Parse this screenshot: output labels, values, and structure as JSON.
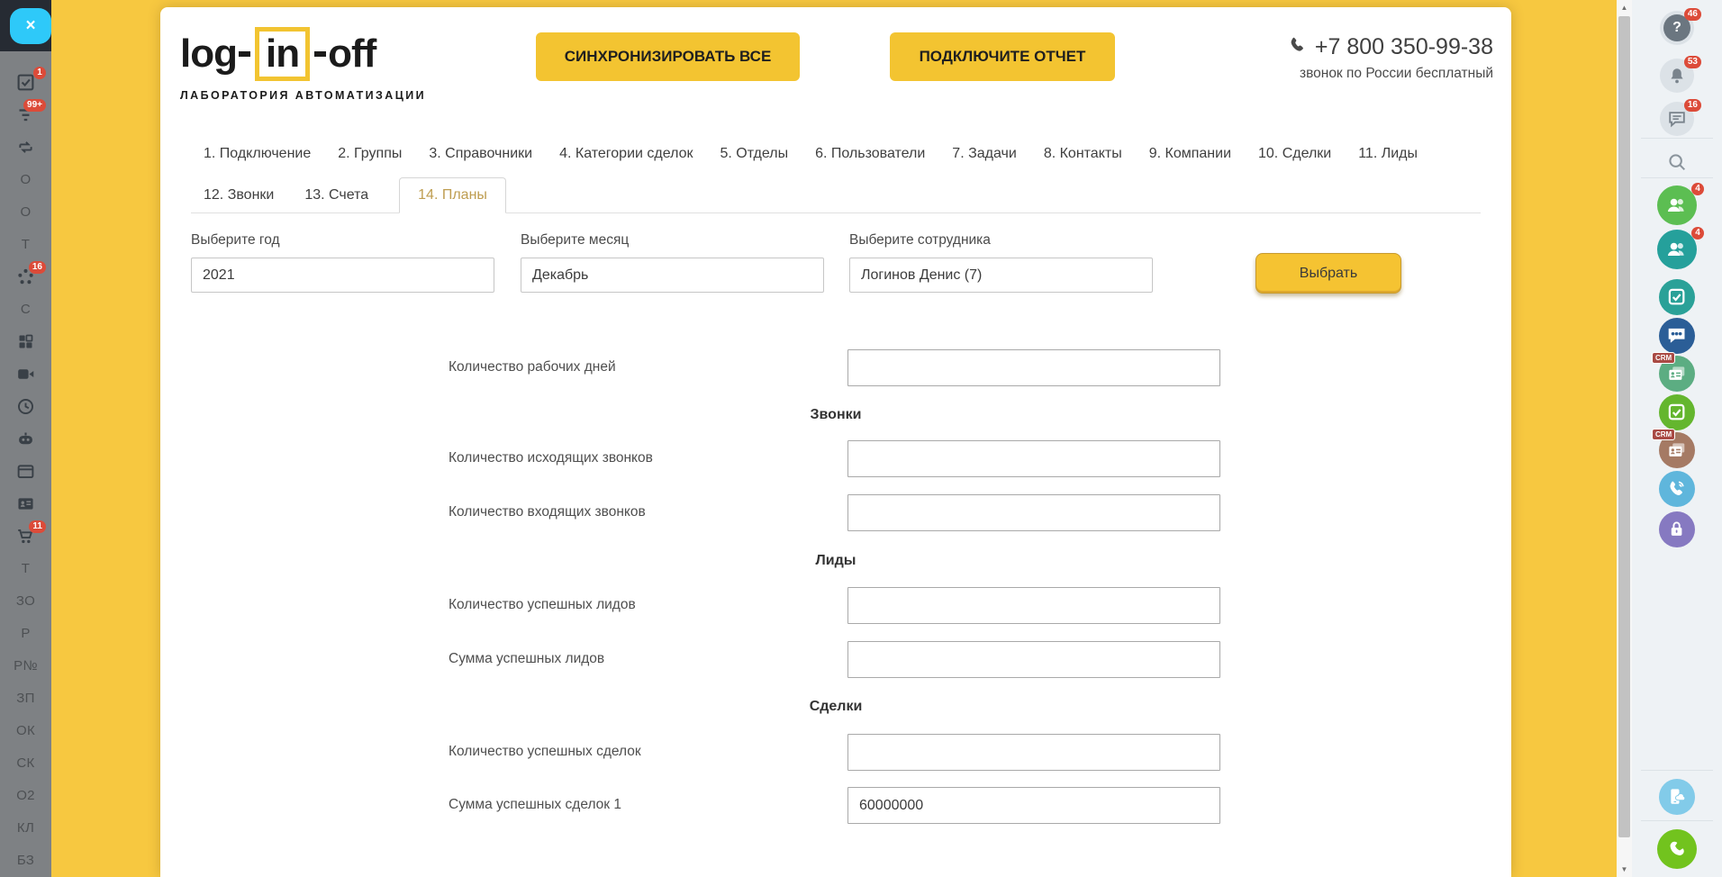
{
  "left_sidebar": {
    "close_label": "×",
    "items": [
      {
        "type": "icon",
        "icon": "tasks",
        "name": "tasks-icon",
        "badge": "1"
      },
      {
        "type": "icon",
        "icon": "filter",
        "name": "filter-icon",
        "badge": "99+"
      },
      {
        "type": "icon",
        "icon": "sync",
        "name": "sync-icon"
      },
      {
        "type": "text",
        "label": "О"
      },
      {
        "type": "text",
        "label": "О"
      },
      {
        "type": "text",
        "label": "Т"
      },
      {
        "type": "icon",
        "icon": "network",
        "name": "network-icon",
        "badge": "16"
      },
      {
        "type": "text",
        "label": "С"
      },
      {
        "type": "icon",
        "icon": "grid",
        "name": "apps-grid-icon"
      },
      {
        "type": "icon",
        "icon": "video",
        "name": "video-icon"
      },
      {
        "type": "icon",
        "icon": "clock",
        "name": "clock-icon"
      },
      {
        "type": "icon",
        "icon": "robot",
        "name": "robot-icon"
      },
      {
        "type": "icon",
        "icon": "window",
        "name": "browser-window-icon"
      },
      {
        "type": "icon",
        "icon": "idcard",
        "name": "contact-card-icon"
      },
      {
        "type": "icon",
        "icon": "cart",
        "name": "cart-icon",
        "badge": "11"
      },
      {
        "type": "text",
        "label": "Т"
      },
      {
        "type": "text",
        "label": "ЗО"
      },
      {
        "type": "text",
        "label": "Р"
      },
      {
        "type": "text",
        "label": "P№"
      },
      {
        "type": "text",
        "label": "ЗП"
      },
      {
        "type": "text",
        "label": "ОК"
      },
      {
        "type": "text",
        "label": "СК"
      },
      {
        "type": "text",
        "label": "О2"
      },
      {
        "type": "text",
        "label": "КЛ"
      },
      {
        "type": "text",
        "label": "БЗ"
      }
    ]
  },
  "header": {
    "logo": {
      "part1": "log",
      "part2": "in",
      "part3": "off",
      "subtitle": "ЛАБОРАТОРИЯ АВТОМАТИЗАЦИИ"
    },
    "sync_all_button": "СИНХРОНИЗИРОВАТЬ ВСЕ",
    "connect_report_button": "ПОДКЛЮЧИТЕ ОТЧЕТ",
    "phone_number": "+7 800 350-99-38",
    "phone_note": "звонок по России бесплатный"
  },
  "tabs": {
    "row1": [
      "1. Подключение",
      "2. Группы",
      "3. Справочники",
      "4. Категории сделок",
      "5. Отделы",
      "6. Пользователи",
      "7. Задачи",
      "8. Контакты",
      "9. Компании",
      "10. Сделки",
      "11. Лиды"
    ],
    "row2": [
      "12. Звонки",
      "13. Счета",
      "14. Планы"
    ],
    "active": "14. Планы"
  },
  "filter_form": {
    "year": {
      "label": "Выберите год",
      "value": "2021"
    },
    "month": {
      "label": "Выберите месяц",
      "value": "Декабрь"
    },
    "employee": {
      "label": "Выберите сотрудника",
      "value": "Логинов Денис (7)"
    },
    "submit_label": "Выбрать"
  },
  "plan_form": {
    "items": [
      {
        "type": "field",
        "label": "Количество рабочих дней",
        "value": ""
      },
      {
        "type": "section",
        "title": "Звонки"
      },
      {
        "type": "field",
        "label": "Количество исходящих звонков",
        "value": ""
      },
      {
        "type": "field",
        "label": "Количество входящих звонков",
        "value": ""
      },
      {
        "type": "section",
        "title": "Лиды"
      },
      {
        "type": "field",
        "label": "Количество успешных лидов",
        "value": ""
      },
      {
        "type": "field",
        "label": "Сумма успешных лидов",
        "value": ""
      },
      {
        "type": "section",
        "title": "Сделки"
      },
      {
        "type": "field",
        "label": "Количество успешных сделок",
        "value": ""
      },
      {
        "type": "field",
        "label": "Сумма успешных сделок 1",
        "value": "60000000"
      }
    ]
  },
  "right_sidebar": {
    "items": [
      {
        "icon": "question",
        "name": "help-icon",
        "badge": "46",
        "style": "question"
      },
      {
        "icon": "bell",
        "name": "notifications-icon",
        "badge": "53",
        "style": "light"
      },
      {
        "icon": "chat-lines",
        "name": "chat-log-icon",
        "badge": "16",
        "style": "light"
      },
      {
        "icon": "search",
        "name": "search-icon",
        "style": "plain",
        "divider_before": true
      },
      {
        "icon": "users",
        "name": "employees-icon",
        "badge": "4",
        "color": "#5CBE52",
        "divider_before": true
      },
      {
        "icon": "users",
        "name": "clients-icon",
        "badge": "4",
        "color": "#25A09B"
      },
      {
        "icon": "check-square",
        "name": "tasks-app-icon",
        "color": "#2AA198"
      },
      {
        "icon": "chat-users",
        "name": "group-chat-icon",
        "color": "#2B5E97"
      },
      {
        "icon": "crm-card",
        "name": "crm-contacts-icon",
        "color": "#5CAD82",
        "tag": "CRM"
      },
      {
        "icon": "check-square",
        "name": "checklist-app-icon",
        "color": "#64B62E"
      },
      {
        "icon": "crm-card",
        "name": "crm-deals-icon",
        "color": "#A57A64",
        "tag": "CRM"
      },
      {
        "icon": "phone-waves",
        "name": "telephony-icon",
        "color": "#5FB6DC"
      },
      {
        "icon": "lock",
        "name": "security-icon",
        "color": "#8679C1"
      },
      {
        "icon": "device-cloud",
        "name": "mobile-app-icon",
        "color": "#82CBE9",
        "divider_before": true
      },
      {
        "icon": "phone-handset",
        "name": "call-icon",
        "color": "#72C31E",
        "divider_before": true
      }
    ],
    "badge_color": "#DC4B39",
    "background": "#EEF2F5"
  },
  "theme": {
    "page_background": "#F7C840",
    "button_yellow": "#F3C431",
    "active_tab_color": "#BE9D50"
  }
}
